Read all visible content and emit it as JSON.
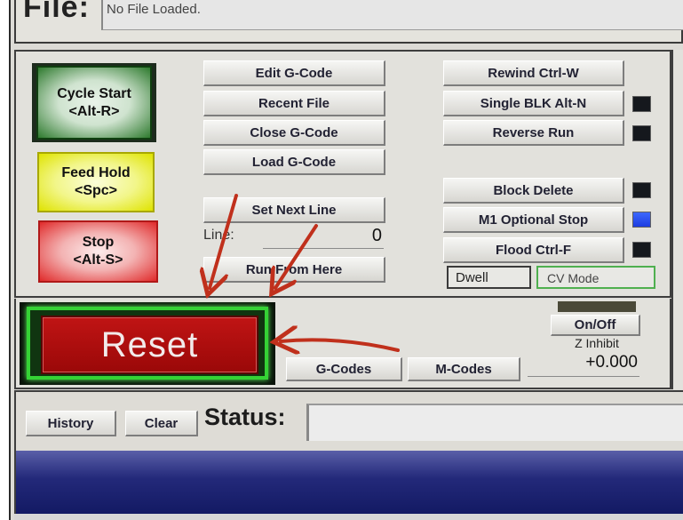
{
  "file": {
    "label": "File:",
    "value": "No File Loaded."
  },
  "cycle_buttons": {
    "cycle_start": "Cycle Start\n<Alt-R>",
    "feed_hold": "Feed Hold\n<Spc>",
    "stop": "Stop\n<Alt-S>"
  },
  "gcode_buttons": {
    "edit": "Edit G-Code",
    "recent": "Recent File",
    "close": "Close G-Code",
    "load": "Load G-Code",
    "set_next_line": "Set Next Line",
    "run_from_here": "Run From Here"
  },
  "line": {
    "label": "Line:",
    "value": "0"
  },
  "right_buttons": {
    "rewind": "Rewind Ctrl-W",
    "single_block": "Single BLK Alt-N",
    "reverse_run": "Reverse Run",
    "block_delete": "Block Delete",
    "m1_optional_stop": "M1 Optional Stop",
    "flood": "Flood Ctrl-F"
  },
  "leds": {
    "single_block": "off",
    "reverse_run": "off",
    "block_delete": "off",
    "m1_optional_stop": "on",
    "flood": "off"
  },
  "colors": {
    "led_on": "#2a4ff0",
    "reset": "#b01010",
    "reset_border": "#35d235",
    "arrow": "#c0301c"
  },
  "modes": {
    "dwell": "Dwell",
    "cv_mode": "CV Mode"
  },
  "reset": {
    "label": "Reset"
  },
  "code_buttons": {
    "g_codes": "G-Codes",
    "m_codes": "M-Codes"
  },
  "z_inhibit": {
    "toggle": "On/Off",
    "label": "Z Inhibit",
    "value": "+0.000"
  },
  "status": {
    "history": "History",
    "clear": "Clear",
    "label": "Status:",
    "value": ""
  }
}
